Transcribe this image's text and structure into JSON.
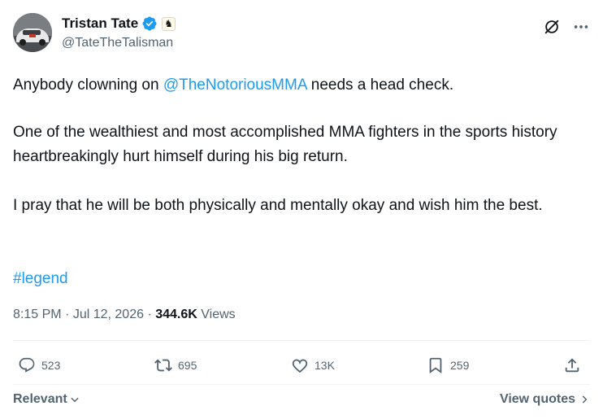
{
  "author": {
    "display_name": "Tristan Tate",
    "handle": "@TateTheTalisman",
    "verified_icon": "verified-badge-icon",
    "affiliation_icon": "chess-knight-icon"
  },
  "tweet": {
    "line1_prefix": "Anybody clowning on ",
    "mention": "@TheNotoriousMMA",
    "line1_suffix": " needs a head check.",
    "paragraph2": "One of the wealthiest and most accomplished MMA fighters in the sports history heartbreakingly hurt himself during his big return.",
    "paragraph3": "I pray that he will be both physically and mentally okay and wish him the best.",
    "hashtag": "#legend"
  },
  "meta": {
    "time": "8:15 PM",
    "sep1": " · ",
    "date": "Jul 12, 2026",
    "sep2": " · ",
    "views_count": "344.6K",
    "views_label": " Views"
  },
  "actions": {
    "replies": "523",
    "retweets": "695",
    "likes": "13K",
    "bookmarks": "259"
  },
  "footer": {
    "sort_label": "Relevant",
    "quotes_label": "View quotes"
  },
  "colors": {
    "accent": "#1d9bf0",
    "secondary_text": "#536471",
    "primary_text": "#0f1419"
  }
}
